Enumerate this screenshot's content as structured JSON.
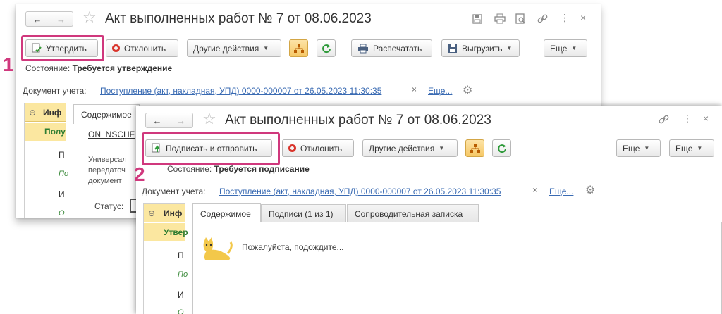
{
  "step_labels": [
    "1",
    "2"
  ],
  "window1": {
    "nav": {
      "back": "←",
      "forward": "→"
    },
    "title": "Акт выполненных работ № 7 от 08.06.2023",
    "toolbar": {
      "approve": "Утвердить",
      "reject": "Отклонить",
      "other_actions": "Другие действия",
      "print": "Распечатать",
      "export": "Выгрузить",
      "more": "Еще"
    },
    "status_label": "Состояние:",
    "status_value": "Требуется утверждение",
    "doc_label": "Документ учета:",
    "doc_link": "Поступление (акт, накладная, УПД) 0000-000007 от 26.05.2023 11:30:35",
    "doc_clear": "×",
    "doc_more": "Еще...",
    "left_panel": {
      "head": "Инф",
      "sub": "Полу",
      "items": [
        "П",
        "По",
        "И",
        "О"
      ]
    },
    "tab_content": "Содержимое",
    "content": {
      "code": "ON_NSCHF",
      "desc_lines": [
        "Универсал",
        "передаточ",
        "документ"
      ],
      "status_label": "Статус:"
    }
  },
  "window2": {
    "nav": {
      "back": "←",
      "forward": "→"
    },
    "title": "Акт выполненных работ № 7 от 08.06.2023",
    "toolbar": {
      "sign_send": "Подписать и отправить",
      "reject": "Отклонить",
      "other_actions": "Другие действия",
      "more1": "Еще",
      "more2": "Еще"
    },
    "status_label": "Состояние:",
    "status_value": "Требуется подписание",
    "doc_label": "Документ учета:",
    "doc_link": "Поступление (акт, накладная, УПД) 0000-000007 от 26.05.2023 11:30:35",
    "doc_clear": "×",
    "doc_more": "Еще...",
    "left_panel": {
      "head": "Инф",
      "sub": "Утвер",
      "items": [
        "П",
        "По",
        "И",
        "О"
      ]
    },
    "tabs": [
      "Содержимое",
      "Подписи (1 из 1)",
      "Сопроводительная записка"
    ],
    "wait_text": "Пожалуйста, подождите..."
  }
}
